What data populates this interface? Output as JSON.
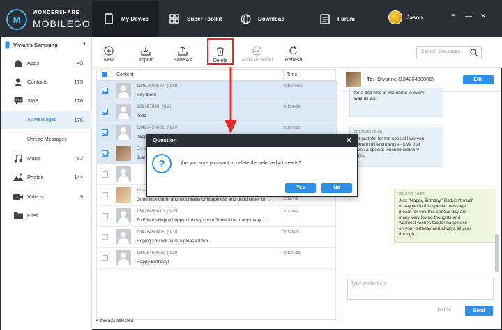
{
  "header": {
    "logo_top": "WONDERSHARE",
    "logo_bottom": "MOBILEGO",
    "logo_letter": "M",
    "tabs": [
      {
        "label": "My Device",
        "icon": "phone-icon"
      },
      {
        "label": "Super Toolkit",
        "icon": "grid-icon"
      },
      {
        "label": "Download",
        "icon": "globe-icon"
      },
      {
        "label": "Forum",
        "icon": "forum-icon"
      }
    ],
    "user": "Jason",
    "controls": [
      "≡",
      "—",
      "✕"
    ]
  },
  "sidebar": {
    "device": "Vivian's Samsung",
    "items": [
      {
        "label": "Apps",
        "count": "43",
        "icon": "apps-icon"
      },
      {
        "label": "Contacts",
        "count": "175",
        "icon": "contacts-icon"
      },
      {
        "label": "SMS",
        "count": "176",
        "icon": "sms-icon"
      },
      {
        "label": "All Messages",
        "count": "176"
      },
      {
        "label": "Unread Messages",
        "count": ""
      },
      {
        "label": "Music",
        "count": "53",
        "icon": "music-icon"
      },
      {
        "label": "Photos",
        "count": "144",
        "icon": "photos-icon"
      },
      {
        "label": "Videos",
        "count": "9",
        "icon": "videos-icon"
      },
      {
        "label": "Files",
        "count": "",
        "icon": "files-icon"
      }
    ]
  },
  "toolbar": {
    "new": "New",
    "import": "Import",
    "save_as": "Save As",
    "delete": "Delete",
    "mark_read": "Mark As Read",
    "refresh": "Refresh",
    "search_placeholder": "Search Messages"
  },
  "list": {
    "col_content": "Content",
    "col_time": "Time",
    "rows": [
      {
        "number": "13467889537",
        "count": "(0/19)",
        "text": "Hey there",
        "date": "2012/10/18",
        "selected": true
      },
      {
        "number": "123457880",
        "count": "(0/3)",
        "text": "hello",
        "date": "2012/9/23",
        "selected": true
      },
      {
        "number": "13426450001",
        "count": "(0/20)",
        "text": "happ",
        "date": "2012/9/20",
        "selected": true
      },
      {
        "number": "Brya",
        "count": "",
        "text": "Just",
        "date": "",
        "selected": true
      },
      {
        "number": "",
        "count": "",
        "text": "",
        "date": "",
        "selected": false
      },
      {
        "number": "Absa",
        "count": "",
        "text": "Good luck chum and mountains of happiness and good cheer on ...",
        "date": "2012/7/6",
        "selected": false
      },
      {
        "number": "13426450010",
        "count": "(0/15)",
        "text": "To FriendsHappy happy birthday chum.There'll be many many ...",
        "date": "2012/6/9",
        "selected": false
      },
      {
        "number": "13426450005",
        "count": "(0/38)",
        "text": "Hoping you will have a pleasant trip.",
        "date": "2012/6/3",
        "selected": false
      },
      {
        "number": "13426450009",
        "count": "(0/30)",
        "text": "Happy Birthday!",
        "date": "2012/1/29",
        "selected": false
      }
    ],
    "footer": "4 threads selected"
  },
  "conversation": {
    "to_label": "To:",
    "contact": "Bryanne (13426450006)",
    "edit": "Edit",
    "bubbles": [
      {
        "date": "",
        "lines": [
          "for a dad who is wonderful in every",
          "way as you."
        ]
      },
      {
        "date": "2012/3/16 20:28",
        "lines": [
          "I'm grateful for the special love you",
          "show in different ways-- love that",
          "gives a special touch to ordinary",
          "days."
        ]
      },
      {
        "date": "2012/6/9 19:02",
        "lines": [
          "Just \"Happy Birthday\",Dad,isn't much",
          "to say,yet in this special message",
          "meant for you this special day are",
          "many very loving thoughts and",
          "warmest wishes,too,for happiness",
          "on your birthday and always,all year",
          "through."
        ]
      }
    ],
    "reply_placeholder": "Type words here",
    "char_count": "0 char",
    "send": "Send"
  },
  "dialog": {
    "title": "Question",
    "close": "✕",
    "icon": "?",
    "message": "Are you sure you want to delete the selected 4 threads?",
    "yes": "Yes",
    "no": "No"
  },
  "colors": {
    "accent": "#2f8ee5",
    "header": "#2a2f36",
    "highlight": "#e02b2b"
  }
}
